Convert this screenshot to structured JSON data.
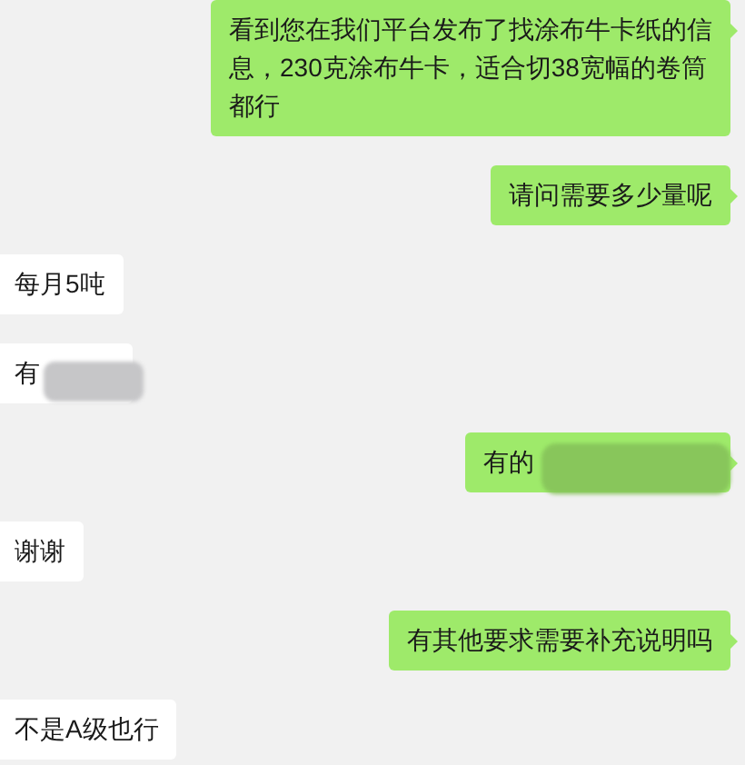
{
  "messages": [
    {
      "kind": "outgoing",
      "text": "看到您在我们平台发布了找涂布牛卡纸的信息，230克涂布牛卡，适合切38宽幅的卷筒都行",
      "redacted": false
    },
    {
      "kind": "outgoing",
      "text": "请问需要多少量呢",
      "redacted": false
    },
    {
      "kind": "incoming",
      "text": "每月5吨",
      "redacted": false
    },
    {
      "kind": "incoming",
      "text": "有",
      "redacted": true
    },
    {
      "kind": "outgoing",
      "text": "有的",
      "redacted": true
    },
    {
      "kind": "incoming",
      "text": "谢谢",
      "redacted": false
    },
    {
      "kind": "outgoing",
      "text": "有其他要求需要补充说明吗",
      "redacted": false
    },
    {
      "kind": "incoming",
      "text": "不是A级也行",
      "redacted": false
    }
  ]
}
